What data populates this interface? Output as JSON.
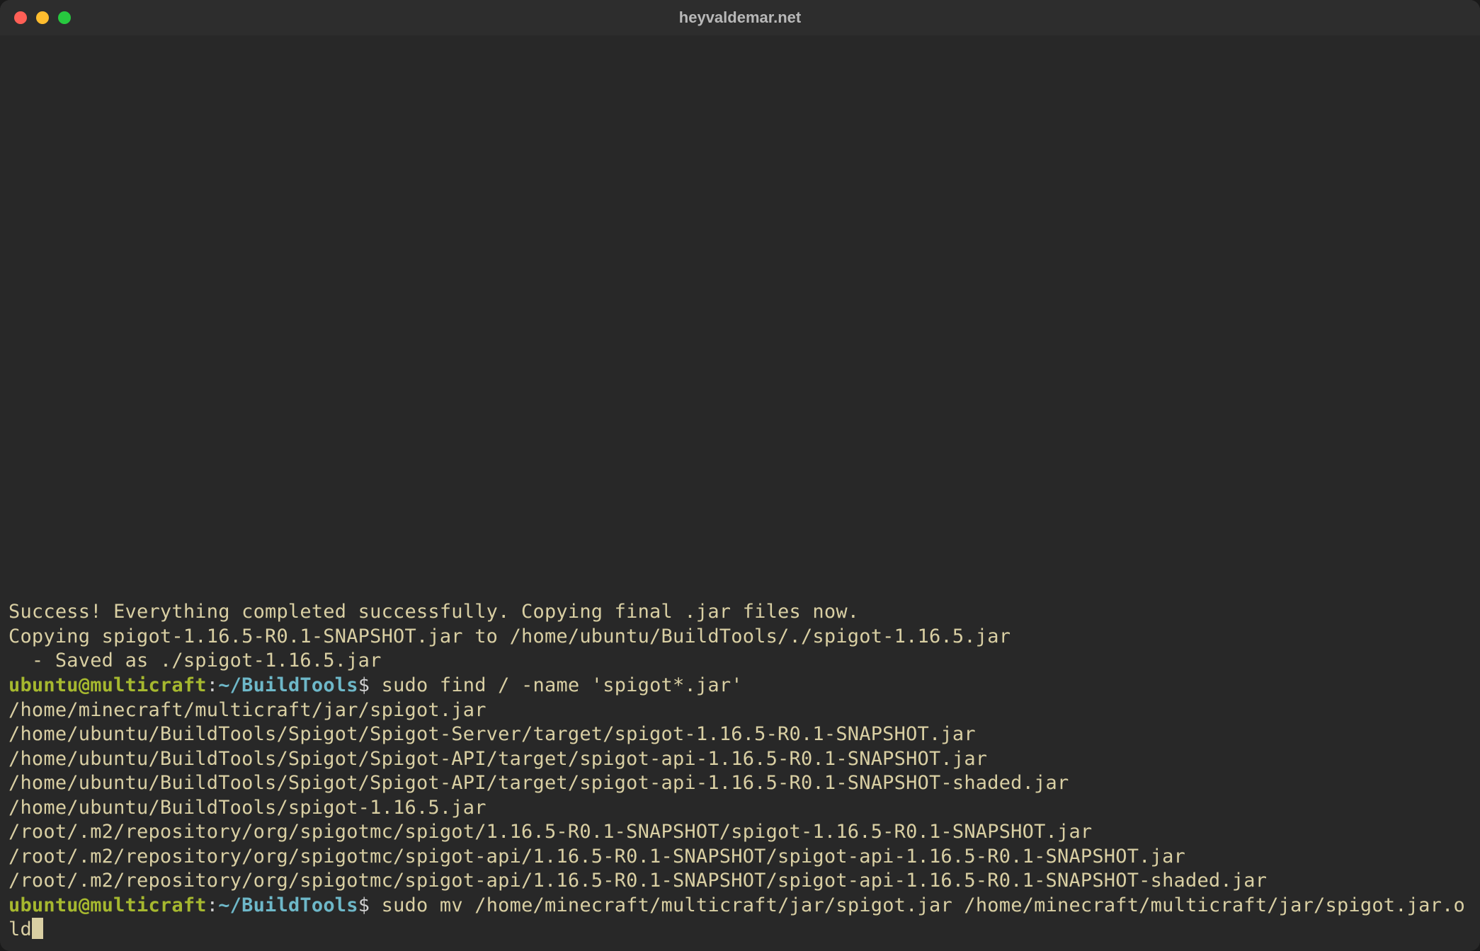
{
  "window": {
    "title": "heyvaldemar.net"
  },
  "output": {
    "lines": [
      "Success! Everything completed successfully. Copying final .jar files now.",
      "Copying spigot-1.16.5-R0.1-SNAPSHOT.jar to /home/ubuntu/BuildTools/./spigot-1.16.5.jar",
      "  - Saved as ./spigot-1.16.5.jar"
    ]
  },
  "prompt1": {
    "user": "ubuntu@multicraft",
    "sep": ":",
    "path": "~/BuildTools",
    "dollar": "$",
    "command": " sudo find / -name 'spigot*.jar'"
  },
  "find_output": {
    "lines": [
      "/home/minecraft/multicraft/jar/spigot.jar",
      "/home/ubuntu/BuildTools/Spigot/Spigot-Server/target/spigot-1.16.5-R0.1-SNAPSHOT.jar",
      "/home/ubuntu/BuildTools/Spigot/Spigot-API/target/spigot-api-1.16.5-R0.1-SNAPSHOT.jar",
      "/home/ubuntu/BuildTools/Spigot/Spigot-API/target/spigot-api-1.16.5-R0.1-SNAPSHOT-shaded.jar",
      "/home/ubuntu/BuildTools/spigot-1.16.5.jar",
      "/root/.m2/repository/org/spigotmc/spigot/1.16.5-R0.1-SNAPSHOT/spigot-1.16.5-R0.1-SNAPSHOT.jar",
      "/root/.m2/repository/org/spigotmc/spigot-api/1.16.5-R0.1-SNAPSHOT/spigot-api-1.16.5-R0.1-SNAPSHOT.jar",
      "/root/.m2/repository/org/spigotmc/spigot-api/1.16.5-R0.1-SNAPSHOT/spigot-api-1.16.5-R0.1-SNAPSHOT-shaded.jar"
    ]
  },
  "prompt2": {
    "user": "ubuntu@multicraft",
    "sep": ":",
    "path": "~/BuildTools",
    "dollar": "$",
    "command": " sudo mv /home/minecraft/multicraft/jar/spigot.jar /home/minecraft/multicraft/jar/spigot.jar.old"
  }
}
